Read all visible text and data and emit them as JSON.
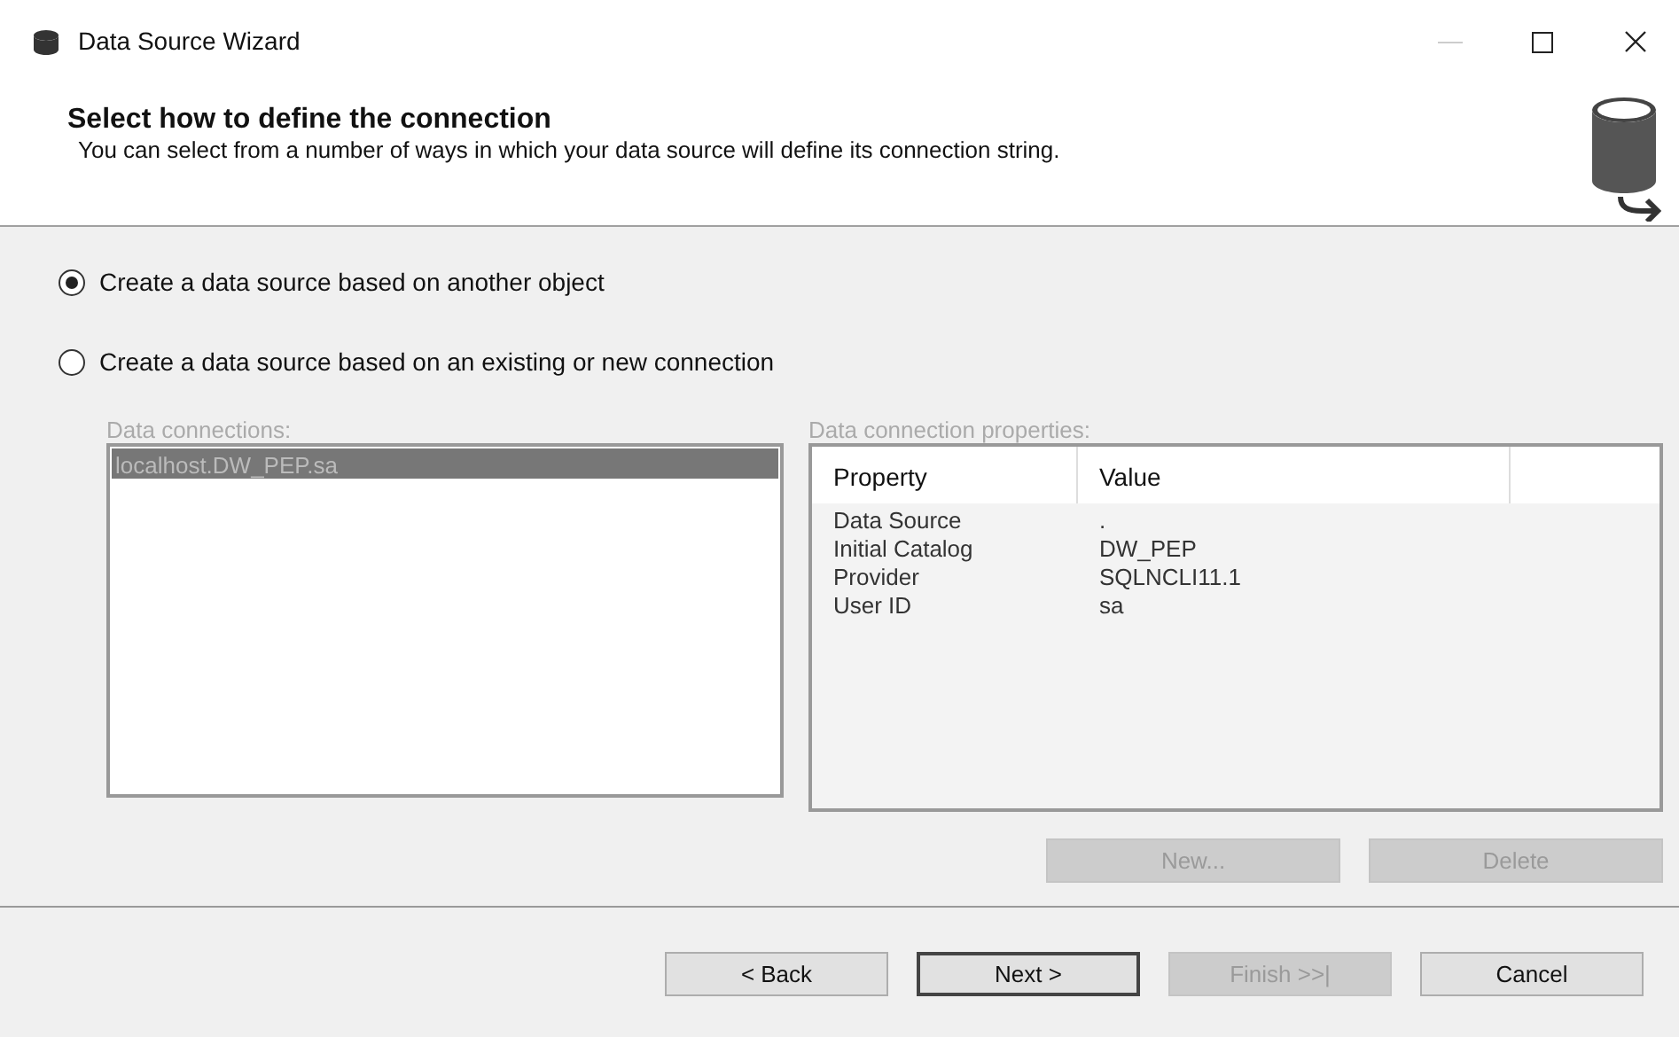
{
  "window": {
    "title": "Data Source Wizard"
  },
  "header": {
    "title": "Select how to define the connection",
    "description": "You can select from a number of ways in which your data source will define its connection string."
  },
  "options": [
    {
      "label": "Create a data source based on another object",
      "selected": true
    },
    {
      "label": "Create a data source based on an existing or new connection",
      "selected": false
    }
  ],
  "connections": {
    "label": "Data connections:",
    "disabled": true,
    "items": [
      {
        "text": "localhost.DW_PEP.sa",
        "selected": true
      }
    ]
  },
  "properties": {
    "label": "Data connection properties:",
    "disabled": true,
    "columns": [
      "Property",
      "Value"
    ],
    "rows": [
      [
        "Data Source",
        "."
      ],
      [
        "Initial Catalog",
        "DW_PEP"
      ],
      [
        "Provider",
        "SQLNCLI11.1"
      ],
      [
        "User ID",
        "sa"
      ]
    ]
  },
  "connection_buttons": [
    {
      "label": "New...",
      "disabled": true
    },
    {
      "label": "Delete",
      "disabled": true
    }
  ],
  "buttons": [
    {
      "label": "< Back",
      "disabled": false,
      "default": false
    },
    {
      "label": "Next >",
      "disabled": false,
      "default": true
    },
    {
      "label": "Finish >>|",
      "disabled": true,
      "default": false
    },
    {
      "label": "Cancel",
      "disabled": false,
      "default": false
    }
  ]
}
